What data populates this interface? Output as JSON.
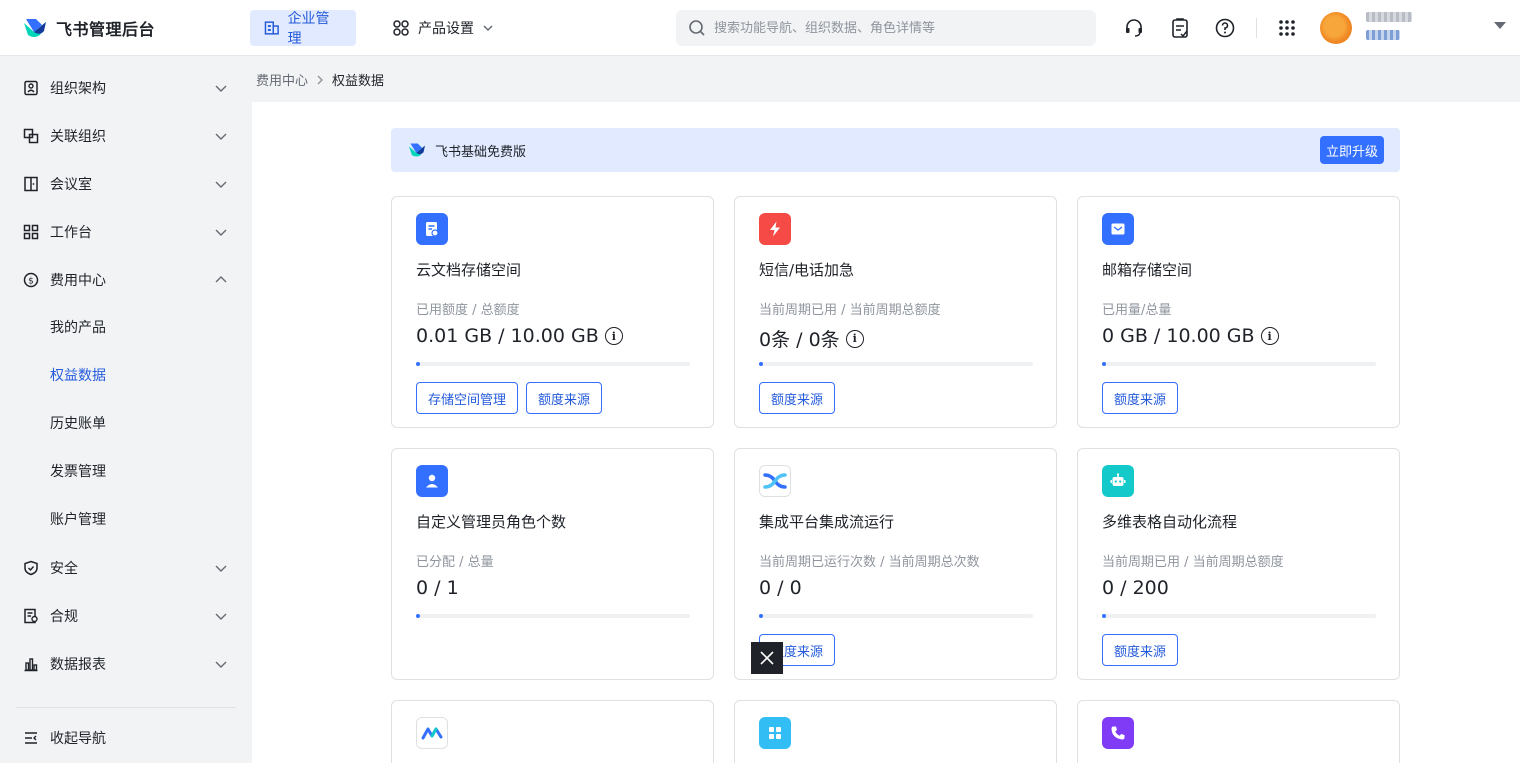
{
  "app": {
    "name": "飞书管理后台"
  },
  "topnav": {
    "enterprise_label": "企业管理",
    "product_label": "产品设置",
    "search_placeholder": "搜索功能导航、组织数据、角色详情等"
  },
  "sidebar": {
    "items": [
      {
        "label": "组织架构",
        "icon": "org-chart-icon"
      },
      {
        "label": "关联组织",
        "icon": "linked-org-icon"
      },
      {
        "label": "会议室",
        "icon": "meeting-room-icon"
      },
      {
        "label": "工作台",
        "icon": "workbench-icon"
      },
      {
        "label": "费用中心",
        "icon": "billing-icon"
      },
      {
        "label": "安全",
        "icon": "shield-icon"
      },
      {
        "label": "合规",
        "icon": "compliance-icon"
      },
      {
        "label": "数据报表",
        "icon": "bar-chart-icon"
      }
    ],
    "sub_items": [
      "我的产品",
      "权益数据",
      "历史账单",
      "发票管理",
      "账户管理"
    ],
    "active_sub": "权益数据",
    "collapse_label": "收起导航"
  },
  "breadcrumb": {
    "parent": "费用中心",
    "current": "权益数据"
  },
  "banner": {
    "title": "飞书基础免费版",
    "upgrade_label": "立即升级"
  },
  "cards": [
    {
      "title": "云文档存储空间",
      "subtitle": "已用额度 / 总额度",
      "value": "0.01 GB / 10.00 GB",
      "info": true,
      "usage": 0.001,
      "buttons": [
        "存储空间管理",
        "额度来源"
      ],
      "icon": "doc-storage-icon",
      "color": "#3370ff"
    },
    {
      "title": "短信/电话加急",
      "subtitle": "当前周期已用 / 当前周期总额度",
      "value": "0条 / 0条",
      "info": true,
      "usage": 0,
      "buttons": [
        "额度来源"
      ],
      "icon": "lightning-icon",
      "color": "#f54a45"
    },
    {
      "title": "邮箱存储空间",
      "subtitle": "已用量/总量",
      "value": "0 GB / 10.00 GB",
      "info": true,
      "usage": 0,
      "buttons": [
        "额度来源"
      ],
      "icon": "mail-icon",
      "color": "#3370ff"
    },
    {
      "title": "自定义管理员角色个数",
      "subtitle": "已分配 / 总量",
      "value": "0 / 1",
      "info": false,
      "usage": 0,
      "buttons": [],
      "icon": "admin-user-icon",
      "color": "#3370ff"
    },
    {
      "title": "集成平台集成流运行",
      "subtitle": "当前周期已运行次数 / 当前周期总次数",
      "value": "0 / 0",
      "info": false,
      "usage": 0,
      "buttons": [
        "额度来源"
      ],
      "icon": "integration-flow-icon",
      "color": "#ffffff"
    },
    {
      "title": "多维表格自动化流程",
      "subtitle": "当前周期已用 / 当前周期总额度",
      "value": "0 / 200",
      "info": false,
      "usage": 0,
      "buttons": [
        "额度来源"
      ],
      "icon": "robot-icon",
      "color": "#14c9c9"
    }
  ],
  "partial_card_icons": [
    {
      "icon": "analytics-icon",
      "color": "#ffffff"
    },
    {
      "icon": "app-grid-icon",
      "color": "#33bdf5"
    },
    {
      "icon": "phone-icon",
      "color": "#7f3bf5"
    }
  ]
}
